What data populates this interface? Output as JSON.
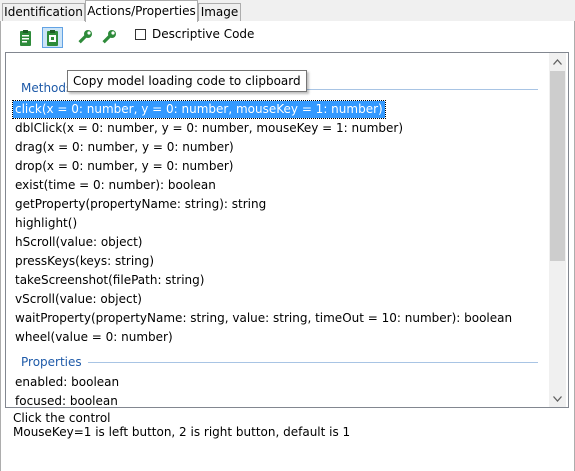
{
  "tabs": [
    "Identification",
    "Actions/Properties",
    "Image"
  ],
  "active_tab": "Actions/Properties",
  "toolbar": {
    "descriptive_code_label": "Descriptive Code",
    "descriptive_code_checked": false,
    "tooltip": "Copy model loading code to clipboard"
  },
  "methods_header": "Methods",
  "methods": [
    "click(x = 0: number, y = 0: number, mouseKey = 1: number)",
    "dblClick(x = 0: number, y = 0: number, mouseKey = 1: number)",
    "drag(x = 0: number, y = 0: number)",
    "drop(x = 0: number, y = 0: number)",
    "exist(time = 0: number): boolean",
    "getProperty(propertyName: string): string",
    "highlight()",
    "hScroll(value: object)",
    "pressKeys(keys: string)",
    "takeScreenshot(filePath: string)",
    "vScroll(value: object)",
    "waitProperty(propertyName: string, value: string, timeOut = 10: number): boolean",
    "wheel(value = 0: number)"
  ],
  "selected_method": "click(x = 0: number, y = 0: number, mouseKey = 1: number)",
  "properties_header": "Properties",
  "properties": [
    "enabled: boolean",
    "focused: boolean"
  ],
  "description": {
    "line1": "Click the control",
    "line2": "MouseKey=1 is left button, 2 is right button, default is 1"
  },
  "colors": {
    "selection": "#3399ff",
    "header": "#1e5aa8",
    "icon_green": "#2e8b3a"
  }
}
